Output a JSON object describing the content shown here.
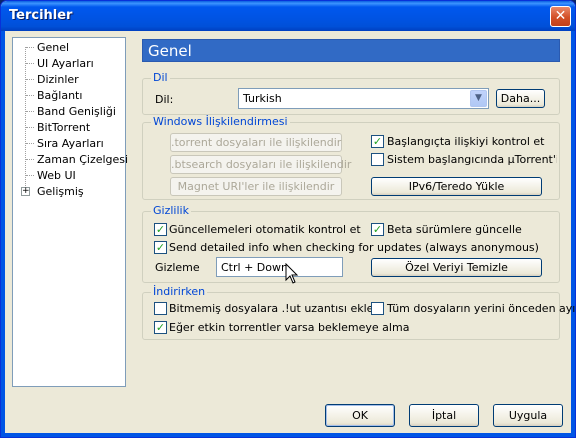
{
  "window": {
    "title": "Tercihler",
    "close_glyph": "✕"
  },
  "tree": {
    "items": [
      {
        "label": "Genel"
      },
      {
        "label": "UI Ayarları"
      },
      {
        "label": "Dizinler"
      },
      {
        "label": "Bağlantı"
      },
      {
        "label": "Band Genişliği"
      },
      {
        "label": "BitTorrent"
      },
      {
        "label": "Sıra Ayarları"
      },
      {
        "label": "Zaman Çizelgesi"
      },
      {
        "label": "Web UI"
      },
      {
        "label": "Gelişmiş"
      }
    ],
    "expander_glyph": "+"
  },
  "panel": {
    "header": "Genel"
  },
  "dil": {
    "group_label": "Dil",
    "field_label": "Dil:",
    "selected": "Turkish",
    "more_button": "Daha..."
  },
  "windows": {
    "group_label": "Windows İlişkilendirmesi",
    "torrent_button": ".torrent dosyaları ile ilişkilendir",
    "btsearch_button": ".btsearch dosyaları ile ilişkilendir",
    "magnet_button": "Magnet URI'ler ile ilişkilendir",
    "check_startup_label": "Başlangıçta ilişkiyi kontrol et",
    "check_startup_checked": true,
    "system_start_label": "Sistem başlangıcında µTorrent'i çalıştır",
    "system_start_checked": false,
    "ipv6_button": "IPv6/Teredo Yükle"
  },
  "privacy": {
    "group_label": "Gizlilik",
    "auto_update_label": "Güncellemeleri otomatik kontrol et",
    "auto_update_checked": true,
    "beta_label": "Beta sürümlere güncelle",
    "beta_checked": true,
    "send_info_label": "Send detailed info when checking for updates (always anonymous)",
    "send_info_checked": true,
    "boss_key_label": "Gizleme",
    "boss_key_value": "Ctrl + Down",
    "clear_private_button": "Özel Veriyi Temizle"
  },
  "downloads": {
    "group_label": "İndirirken",
    "ut_ext_label": "Bitmemiş dosyalara .!ut uzantısı ekle",
    "ut_ext_checked": false,
    "prealloc_label": "Tüm dosyaların yerini önceden ayır",
    "prealloc_checked": false,
    "prevent_standby_label": "Eğer etkin torrentler varsa beklemeye alma",
    "prevent_standby_checked": true
  },
  "footer": {
    "ok": "OK",
    "cancel": "İptal",
    "apply": "Uygula"
  },
  "check_glyph": "✓"
}
